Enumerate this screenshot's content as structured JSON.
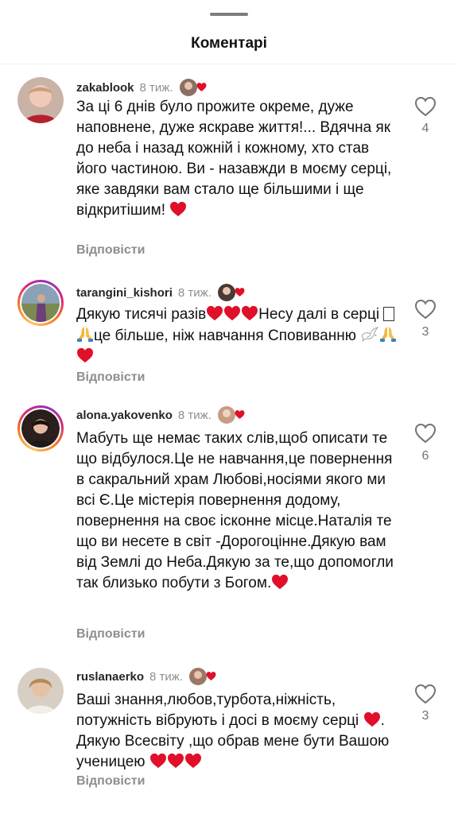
{
  "header": {
    "title": "Коментарі"
  },
  "reply_label": "Відповісти",
  "colors": {
    "heart": "#e0102a",
    "muted": "#8e8e8e"
  },
  "comments": [
    {
      "username": "zakablook",
      "time": "8 тиж.",
      "text": "За ці 6 днів було прожите окреме, дуже наповнене, дуже яскраве життя!... Вдячна як до неба і назад кожній і кожному, хто став його частиною. Ви - назавжди в моєму серці, яке завдяки вам стало ще більшими і ще відкритішим!",
      "likes": "4",
      "story_ring": false
    },
    {
      "username": "tarangini_kishori",
      "time": "8 тиж.",
      "text_a": "Дякую тисячі разів",
      "text_b": "Несу далі в серці ",
      "text_c": "це більше, ніж навчання Сповиванню",
      "likes": "3",
      "story_ring": true
    },
    {
      "username": "alona.yakovenko",
      "time": "8 тиж.",
      "text": "Мабуть ще немає таких слів,щоб описати те що відбулося.Це не навчання,це повернення в сакральний храм Любові,носіями якого ми всі Є.Це містерія повернення додому, повернення на своє ісконне місце.Наталія те що ви несете в світ -Дорогоцінне.Дякую вам від Землі до Неба.Дякую за те,що допомогли так близько побути з Богом.",
      "likes": "6",
      "story_ring": true
    },
    {
      "username": "ruslanaerko",
      "time": "8 тиж.",
      "text_a": "Ваші знання,любов,турбота,ніжність, потужність вібрують і досі в моєму серці ",
      "text_b": ". Дякую Всесвіту ,що обрав мене бути Вашою ученицею ",
      "likes": "3",
      "story_ring": false
    }
  ]
}
